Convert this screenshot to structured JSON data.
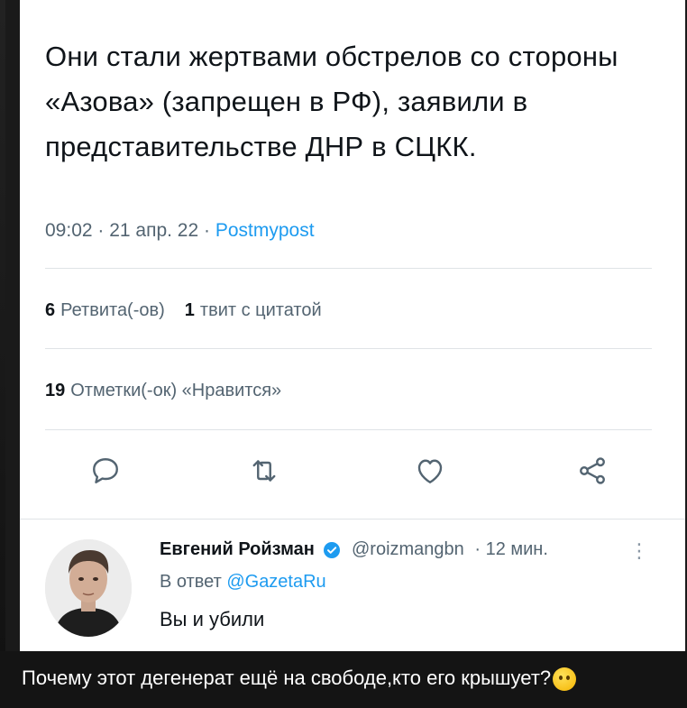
{
  "tweet": {
    "text": "Они стали жертвами обстрелов со стороны «Азова» (запрещен в РФ), заявили в представительстве ДНР в СЦКК.",
    "time": "09:02 · 21 апр. 22 · ",
    "source": "Postmypost"
  },
  "stats": {
    "retweets_count": "6",
    "retweets_label": "Ретвита(-ов)",
    "quotes_count": "1",
    "quotes_label": "твит с цитатой",
    "likes_count": "19",
    "likes_label": "Отметки(-ок) «Нравится»"
  },
  "actions": {
    "icons": [
      "reply-icon",
      "retweet-icon",
      "like-icon",
      "share-icon"
    ]
  },
  "reply": {
    "name": "Евгений Ройзман",
    "handle": "@roizmangbn",
    "time": "· 12 мин.",
    "more": "⋮",
    "in_reply_prefix": "В ответ",
    "in_reply_mention": "@GazetaRu",
    "text": "Вы и убили"
  },
  "caption": {
    "text": "Почему этот дегенерат ещё на свободе,кто его крышует?"
  },
  "colors": {
    "accent": "#1d9bf0",
    "text": "#0f1419",
    "muted": "#536471",
    "caption_bg": "#141414"
  }
}
